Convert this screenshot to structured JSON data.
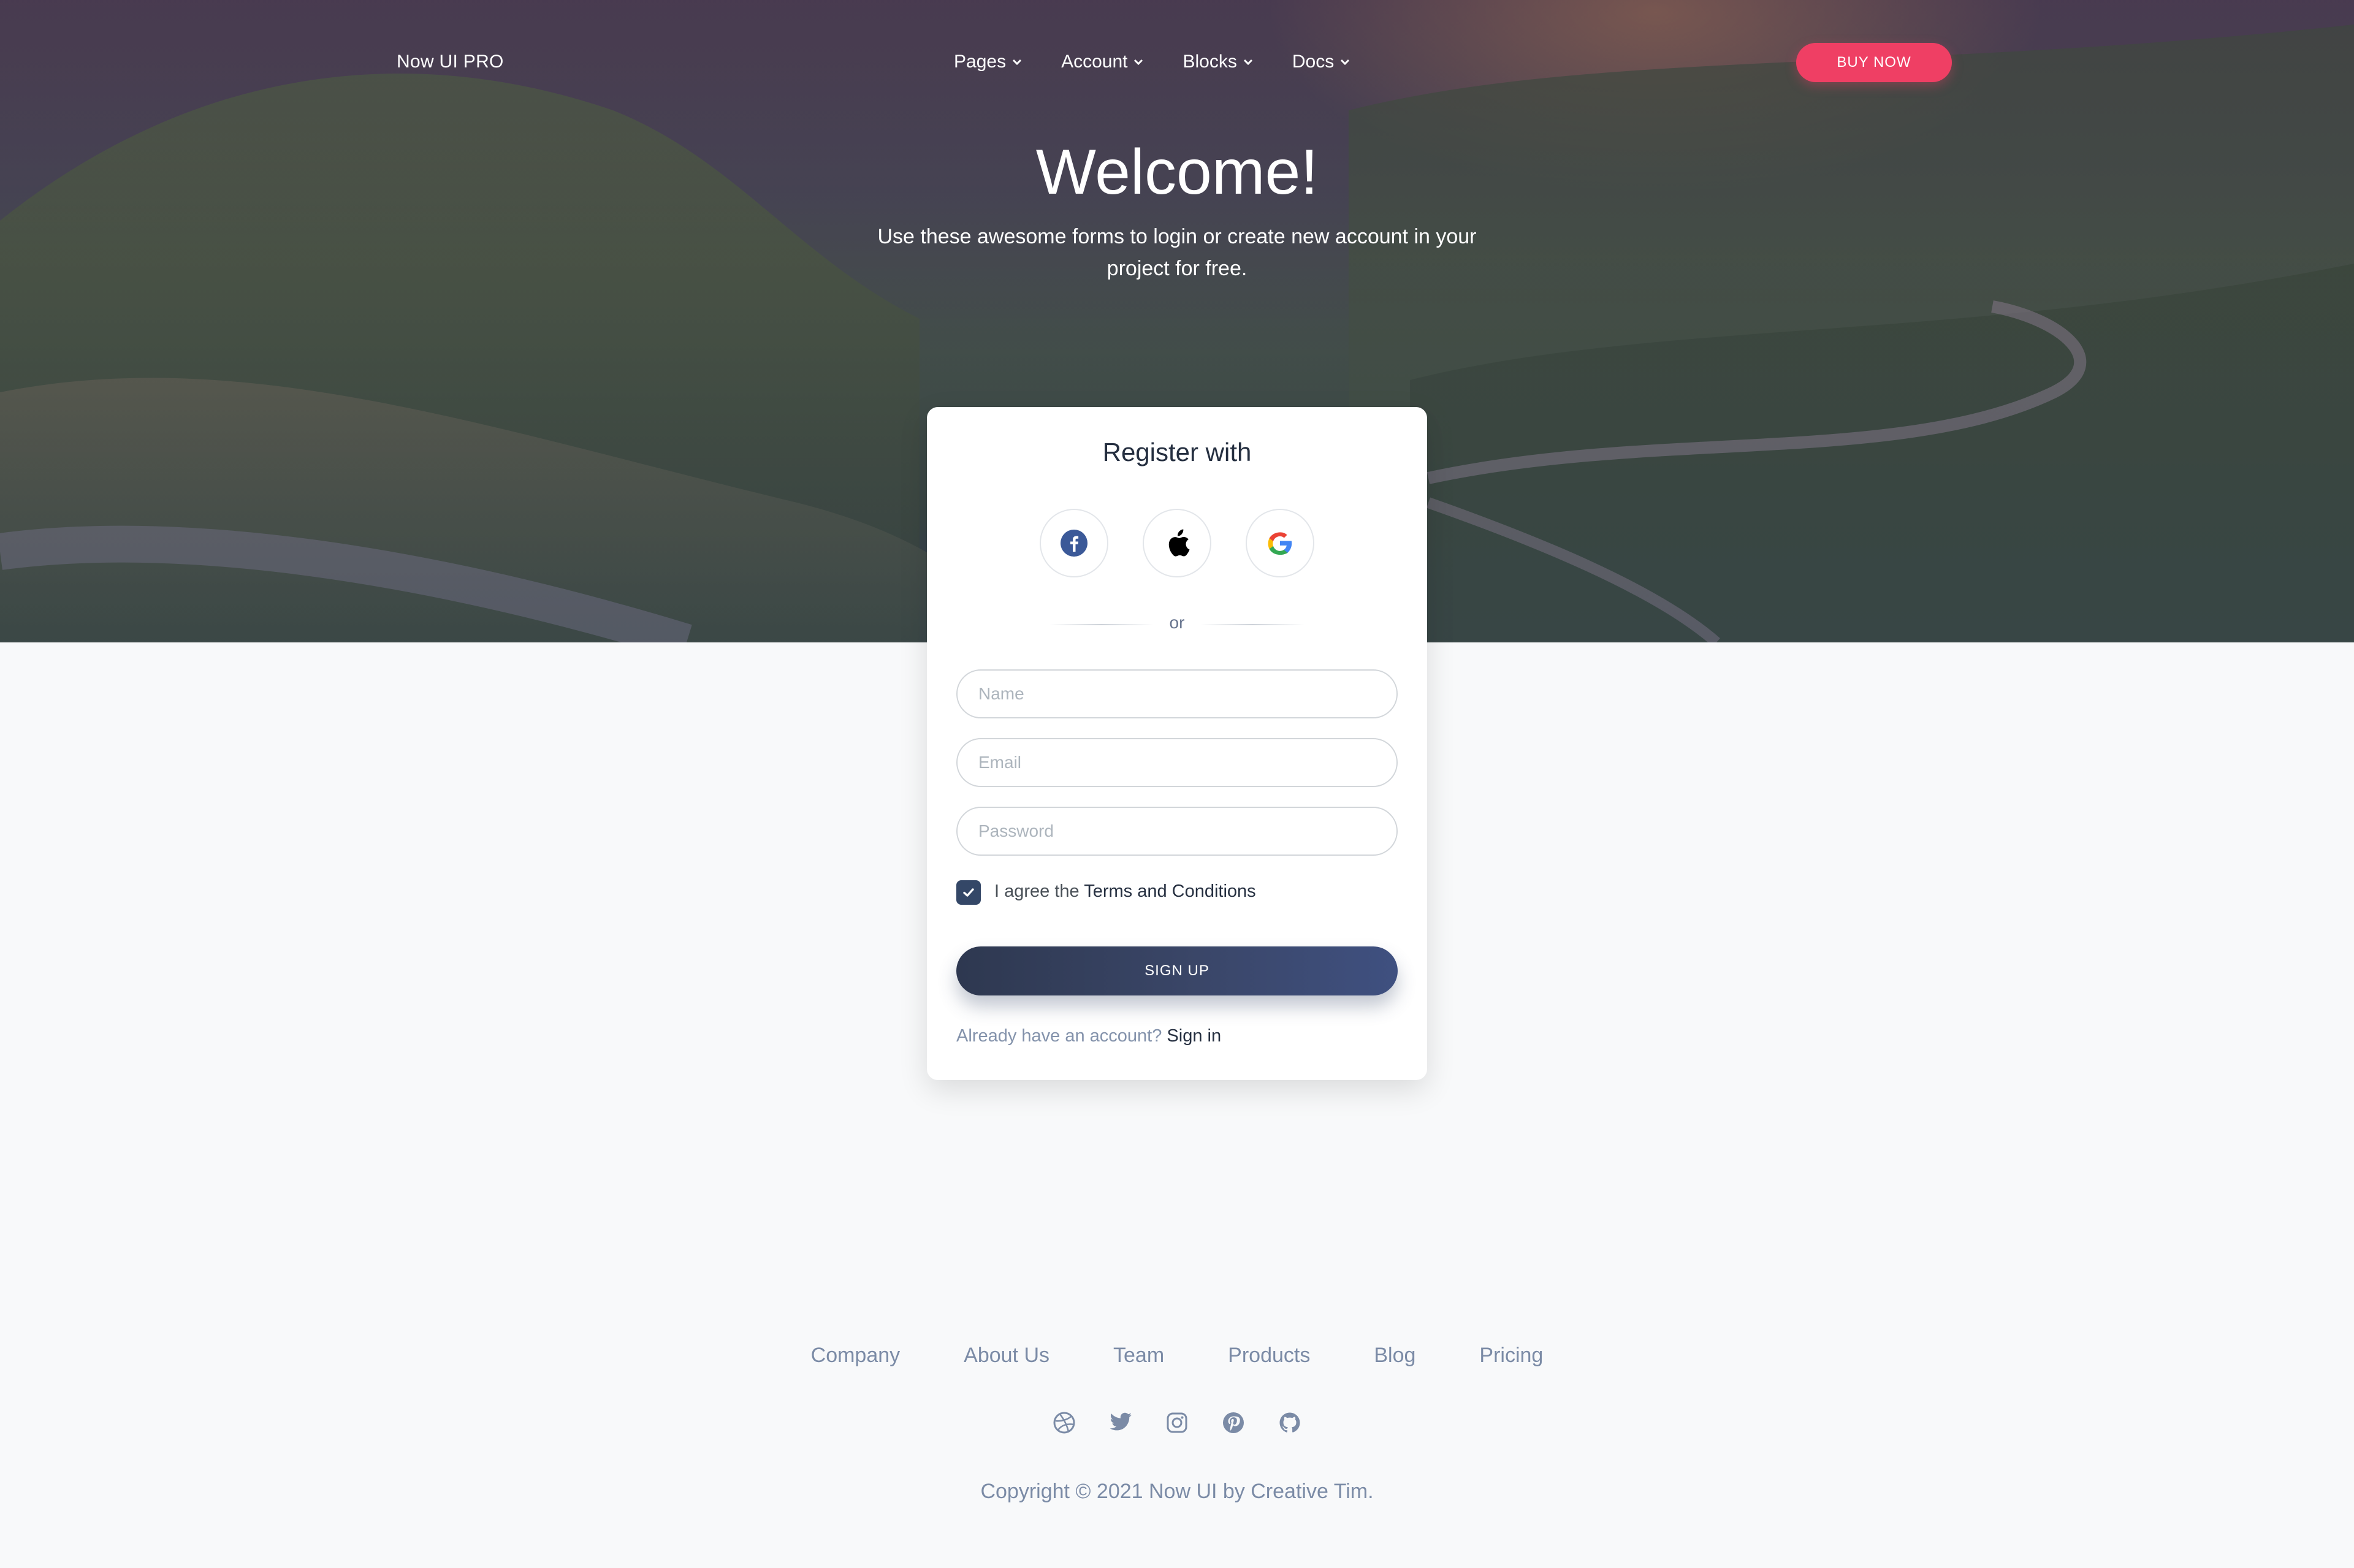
{
  "navbar": {
    "brand": "Now UI PRO",
    "items": [
      {
        "label": "Pages"
      },
      {
        "label": "Account"
      },
      {
        "label": "Blocks"
      },
      {
        "label": "Docs"
      }
    ],
    "buy_label": "BUY NOW"
  },
  "hero": {
    "title": "Welcome!",
    "subtitle": "Use these awesome forms to login or create new account in your project for free."
  },
  "register": {
    "title": "Register with",
    "social": [
      "facebook-icon",
      "apple-icon",
      "google-icon"
    ],
    "or_label": "or",
    "name_placeholder": "Name",
    "email_placeholder": "Email",
    "password_placeholder": "Password",
    "agree_prefix": "I agree the",
    "terms_label": "Terms and Conditions",
    "terms_checked": true,
    "signup_label": "SIGN UP",
    "have_account": "Already have an account?",
    "signin_label": "Sign in"
  },
  "footer": {
    "links": [
      "Company",
      "About Us",
      "Team",
      "Products",
      "Blog",
      "Pricing"
    ],
    "social_icons": [
      "dribbble-icon",
      "twitter-icon",
      "instagram-icon",
      "pinterest-icon",
      "github-icon"
    ],
    "copyright": "Copyright © 2021 Now UI by Creative Tim."
  },
  "colors": {
    "accent": "#ef3f64",
    "primary_dark": "#344767",
    "page_bg": "#f8f9fa",
    "muted_text": "#7b8ba6"
  }
}
